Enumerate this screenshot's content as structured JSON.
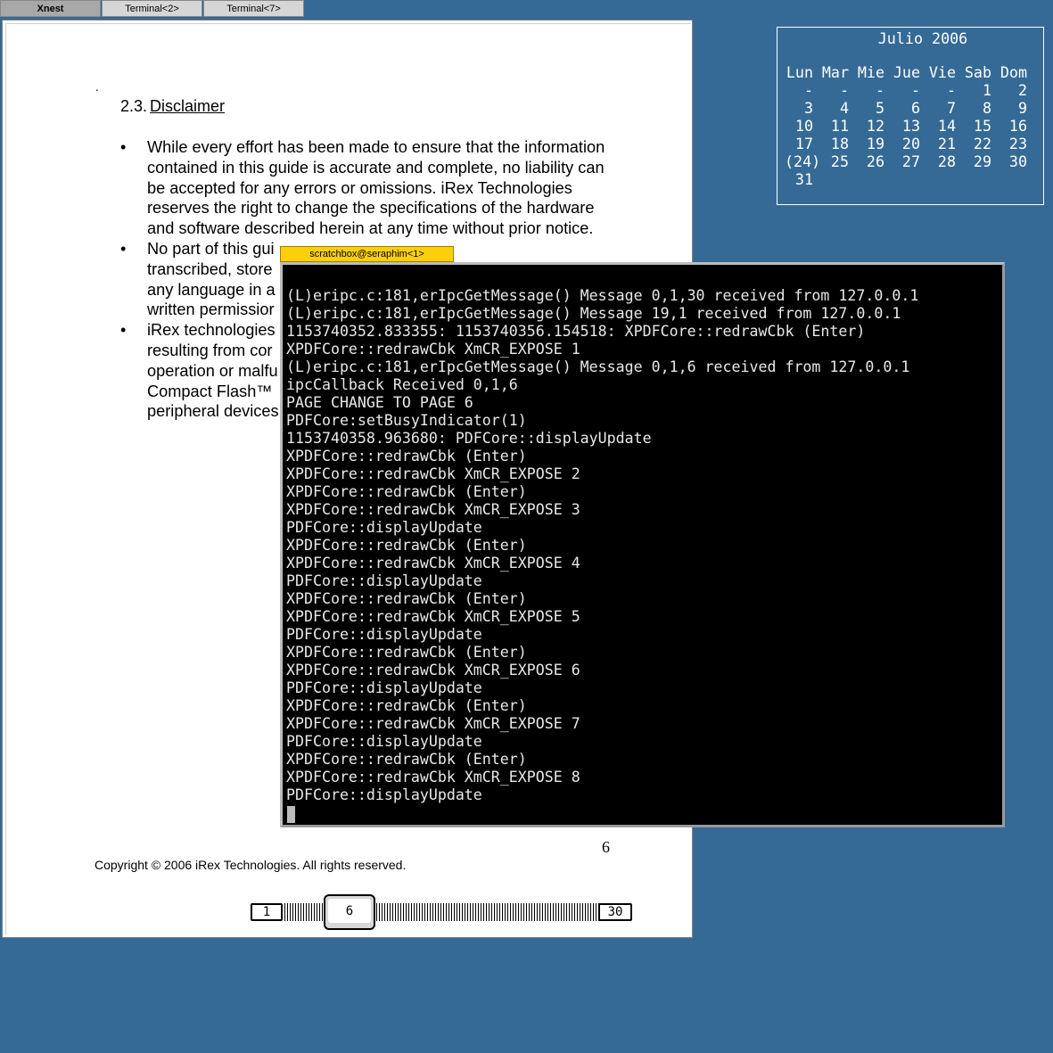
{
  "taskbar": {
    "tabs": [
      {
        "label": "Xnest",
        "active": true
      },
      {
        "label": "Terminal<2>",
        "active": false
      },
      {
        "label": "Terminal<7>",
        "active": false
      }
    ]
  },
  "pdf": {
    "dot": ".",
    "section_number": "2.3.",
    "section_title": "Disclaimer",
    "bullets": [
      "While every effort has been made to ensure that the information contained in this guide is accurate and complete, no liability can be accepted for any errors or omissions. iRex Technologies reserves the right to change the specifications of the hardware and software described herein at any time without prior notice.",
      "No part of this gui                                                                                transcribed, store                                                                              any language in a                                                                              written permissior",
      "iRex technologies                                                                               resulting from cor                                                                               operation or malfu                                                                              Compact Flash™                                                                                  peripheral devices"
    ],
    "page_number": "6",
    "copyright": "Copyright © 2006 iRex Technologies. All rights reserved."
  },
  "pager": {
    "first": "1",
    "current": "6",
    "last": "30",
    "current_page": 6,
    "total_pages": 30
  },
  "calendar": {
    "title": "Julio 2006",
    "weekdays": [
      "Lun",
      "Mar",
      "Mie",
      "Jue",
      "Vie",
      "Sab",
      "Dom"
    ],
    "weeks": [
      [
        "-",
        "-",
        "-",
        "-",
        "-",
        "1",
        "2"
      ],
      [
        "3",
        "4",
        "5",
        "6",
        "7",
        "8",
        "9"
      ],
      [
        "10",
        "11",
        "12",
        "13",
        "14",
        "15",
        "16"
      ],
      [
        "17",
        "18",
        "19",
        "20",
        "21",
        "22",
        "23"
      ],
      [
        "(24)",
        "25",
        "26",
        "27",
        "28",
        "29",
        "30"
      ],
      [
        "31",
        "",
        "",
        "",
        "",
        "",
        ""
      ]
    ]
  },
  "terminal": {
    "title": "scratchbox@seraphim<1>",
    "lines": [
      "(L)eripc.c:181,erIpcGetMessage() Message 0,1,30 received from 127.0.0.1",
      "(L)eripc.c:181,erIpcGetMessage() Message 19,1 received from 127.0.0.1",
      "1153740352.833355: 1153740356.154518: XPDFCore::redrawCbk (Enter)",
      "XPDFCore::redrawCbk XmCR_EXPOSE 1",
      "(L)eripc.c:181,erIpcGetMessage() Message 0,1,6 received from 127.0.0.1",
      "ipcCallback Received 0,1,6",
      "PAGE CHANGE TO PAGE 6",
      "PDFCore:setBusyIndicator(1)",
      "1153740358.963680: PDFCore::displayUpdate",
      "XPDFCore::redrawCbk (Enter)",
      "XPDFCore::redrawCbk XmCR_EXPOSE 2",
      "XPDFCore::redrawCbk (Enter)",
      "XPDFCore::redrawCbk XmCR_EXPOSE 3",
      "PDFCore::displayUpdate",
      "XPDFCore::redrawCbk (Enter)",
      "XPDFCore::redrawCbk XmCR_EXPOSE 4",
      "PDFCore::displayUpdate",
      "XPDFCore::redrawCbk (Enter)",
      "XPDFCore::redrawCbk XmCR_EXPOSE 5",
      "PDFCore::displayUpdate",
      "XPDFCore::redrawCbk (Enter)",
      "XPDFCore::redrawCbk XmCR_EXPOSE 6",
      "PDFCore::displayUpdate",
      "XPDFCore::redrawCbk (Enter)",
      "XPDFCore::redrawCbk XmCR_EXPOSE 7",
      "PDFCore::displayUpdate",
      "XPDFCore::redrawCbk (Enter)",
      "XPDFCore::redrawCbk XmCR_EXPOSE 8",
      "PDFCore::displayUpdate"
    ]
  },
  "colors": {
    "desktop": "#356a97",
    "terminal_bg": "#000000",
    "terminal_fg": "#e8e8e8",
    "terminal_title_bg": "#fccf0b"
  }
}
